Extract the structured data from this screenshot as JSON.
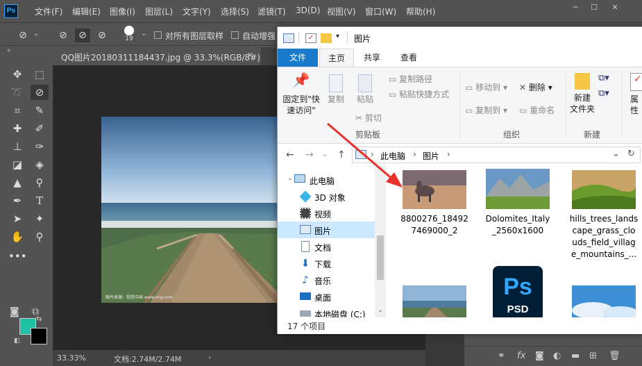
{
  "ps": {
    "logo": "Ps",
    "menu": [
      "文件(F)",
      "编辑(E)",
      "图像(I)",
      "图层(L)",
      "文字(Y)",
      "选择(S)",
      "滤镜(T)",
      "3D(D)",
      "视图(V)",
      "窗口(W)",
      "帮助(H)"
    ],
    "options": {
      "brush_size": "19",
      "sample_all_layers": "对所有图层取样",
      "auto_enhance": "自动增强"
    },
    "doc_tab": "QQ图片20180311184437.jpg @ 33.3%(RGB/8#)",
    "status": {
      "zoom": "33.33%",
      "doc": "文档:2.74M/2.74M"
    },
    "watermark": "图片来源：视觉中国 www.vcg.com",
    "colors": {
      "foreground": "#20c0a5",
      "background": "#000000"
    }
  },
  "explorer": {
    "title": "图片",
    "tabs": {
      "file": "文件",
      "home": "主页",
      "share": "共享",
      "view": "查看"
    },
    "ribbon": {
      "pin": "固定到\"快\n速访问\"",
      "copy": "复制",
      "paste": "粘贴",
      "copy_path": "复制路径",
      "paste_shortcut": "粘贴快捷方式",
      "cut": "剪切",
      "clipboard_group": "剪贴板",
      "move_to": "移动到",
      "copy_to": "复制到",
      "delete": "删除",
      "rename": "重命名",
      "organize_group": "组织",
      "new_folder": "新建\n文件夹",
      "new_group": "新建",
      "properties": "属性"
    },
    "breadcrumb": [
      "此电脑",
      "图片"
    ],
    "nav": [
      "此电脑",
      "3D 对象",
      "视频",
      "图片",
      "文档",
      "下载",
      "音乐",
      "桌面",
      "本地磁盘 (C:)"
    ],
    "files": [
      {
        "name": "8800276_18492\n7469000_2"
      },
      {
        "name": "Dolomites_Italy\n_2560x1600"
      },
      {
        "name": "hills_trees_lands\ncape_grass_clo\nuds_field_villag\ne_mountains_..."
      },
      {
        "name": ""
      },
      {
        "name": "",
        "badge": "PSD"
      },
      {
        "name": ""
      }
    ],
    "status": "17 个项目"
  }
}
